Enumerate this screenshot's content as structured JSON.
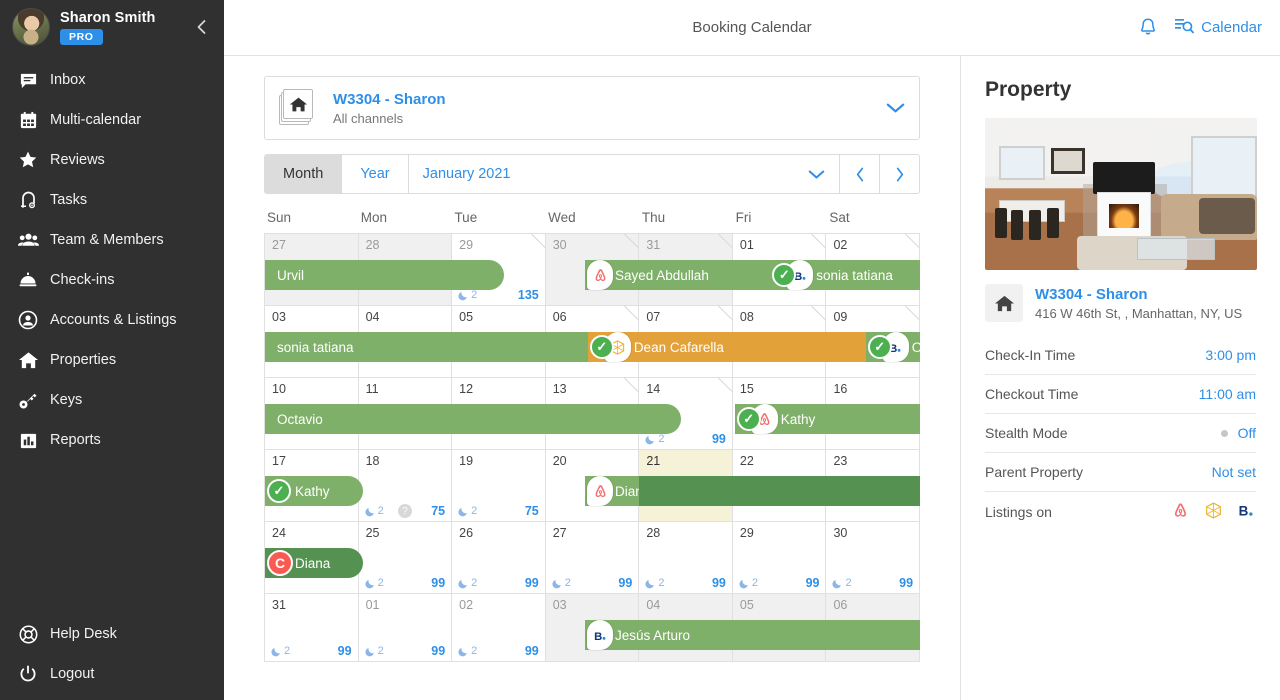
{
  "sidebar": {
    "user": {
      "name": "Sharon Smith",
      "badge": "PRO",
      "avatar_icon": "user-avatar"
    },
    "collapse_icon": "chevron-left-icon",
    "items": [
      {
        "label": "Inbox",
        "icon": "inbox-message-icon"
      },
      {
        "label": "Multi-calendar",
        "icon": "calendar-icon"
      },
      {
        "label": "Reviews",
        "icon": "star-icon"
      },
      {
        "label": "Tasks",
        "icon": "vacuum-icon"
      },
      {
        "label": "Team & Members",
        "icon": "people-icon"
      },
      {
        "label": "Check-ins",
        "icon": "bell-service-icon"
      },
      {
        "label": "Accounts & Listings",
        "icon": "account-circle-icon"
      },
      {
        "label": "Properties",
        "icon": "home-icon"
      },
      {
        "label": "Keys",
        "icon": "key-icon"
      },
      {
        "label": "Reports",
        "icon": "bar-chart-icon"
      }
    ],
    "bottom_items": [
      {
        "label": "Help Desk",
        "icon": "lifebuoy-icon"
      },
      {
        "label": "Logout",
        "icon": "power-icon"
      }
    ]
  },
  "topbar": {
    "title": "Booking Calendar",
    "notification_icon": "bell-icon",
    "calendar_label": "Calendar",
    "calendar_icon": "calendar-search-icon"
  },
  "property_selector": {
    "name": "W3304 - Sharon",
    "subtitle": "All channels",
    "icon": "properties-stack-icon",
    "caret_icon": "chevron-down-icon"
  },
  "toolbar": {
    "month_label": "Month",
    "year_label": "Year",
    "active": "Month",
    "period": "January 2021",
    "caret_icon": "chevron-down-icon",
    "prev_icon": "chevron-left-icon",
    "next_icon": "chevron-right-icon"
  },
  "calendar": {
    "dow": [
      "Sun",
      "Mon",
      "Tue",
      "Wed",
      "Thu",
      "Fri",
      "Sat"
    ],
    "weeks": [
      {
        "days": [
          {
            "n": "27",
            "cur": false
          },
          {
            "n": "28",
            "cur": false
          },
          {
            "n": "29",
            "cur": false,
            "white": true,
            "nights": "2",
            "price": "135",
            "diag": true
          },
          {
            "n": "30",
            "cur": false,
            "diag": true
          },
          {
            "n": "31",
            "cur": false,
            "diag": true
          },
          {
            "n": "01",
            "cur": true,
            "diag": true
          },
          {
            "n": "02",
            "cur": true,
            "diag": true
          }
        ],
        "bars": [
          {
            "label": "Urvil",
            "start": 0,
            "end": 2.55,
            "color": "green",
            "round": "right"
          },
          {
            "label": "Sayed Abdullah",
            "start": 3.42,
            "end": 5.4,
            "color": "green",
            "badges": [
              "airbnb"
            ]
          },
          {
            "label": "sonia tatiana",
            "start": 5.4,
            "end": 7,
            "color": "green",
            "badges": [
              "check",
              "booking"
            ]
          }
        ]
      },
      {
        "days": [
          {
            "n": "03",
            "cur": true
          },
          {
            "n": "04",
            "cur": true
          },
          {
            "n": "05",
            "cur": true
          },
          {
            "n": "06",
            "cur": true,
            "diag": true
          },
          {
            "n": "07",
            "cur": true,
            "diag": true
          },
          {
            "n": "08",
            "cur": true,
            "diag": true
          },
          {
            "n": "09",
            "cur": true,
            "diag": true
          }
        ],
        "bars": [
          {
            "label": "sonia tatiana",
            "start": 0,
            "end": 3.45,
            "color": "green"
          },
          {
            "label": "Dean Cafarella",
            "start": 3.45,
            "end": 6.42,
            "color": "orange",
            "badges": [
              "check",
              "home"
            ]
          },
          {
            "label": "Oc…",
            "start": 6.42,
            "end": 7,
            "color": "green",
            "badges": [
              "check",
              "booking"
            ]
          }
        ]
      },
      {
        "days": [
          {
            "n": "10",
            "cur": true
          },
          {
            "n": "11",
            "cur": true
          },
          {
            "n": "12",
            "cur": true
          },
          {
            "n": "13",
            "cur": true,
            "diag": true
          },
          {
            "n": "14",
            "cur": true,
            "white": true,
            "nights": "2",
            "price": "99",
            "diag": true
          },
          {
            "n": "15",
            "cur": true
          },
          {
            "n": "16",
            "cur": true
          }
        ],
        "bars": [
          {
            "label": "Octavio",
            "start": 0,
            "end": 4.45,
            "color": "green",
            "round": "right"
          },
          {
            "label": "Kathy",
            "start": 5.02,
            "end": 7,
            "color": "green",
            "badges": [
              "check",
              "airbnb"
            ]
          }
        ]
      },
      {
        "days": [
          {
            "n": "17",
            "cur": true
          },
          {
            "n": "18",
            "cur": true,
            "white": true,
            "nights": "2",
            "price": "75",
            "qmark": true
          },
          {
            "n": "19",
            "cur": true,
            "white": true,
            "nights": "2",
            "price": "75"
          },
          {
            "n": "20",
            "cur": true
          },
          {
            "n": "21",
            "cur": true,
            "today": true
          },
          {
            "n": "22",
            "cur": true
          },
          {
            "n": "23",
            "cur": true
          }
        ],
        "bars": [
          {
            "label": "Kathy",
            "start": 0,
            "end": 1.05,
            "color": "green",
            "round": "right",
            "badges": [
              "check-plain"
            ]
          },
          {
            "label": "Diana",
            "start": 3.42,
            "end": 4.0,
            "color": "green",
            "badges": [
              "airbnb"
            ]
          },
          {
            "label": "",
            "start": 4.0,
            "end": 7,
            "color": "green2"
          }
        ]
      },
      {
        "days": [
          {
            "n": "24",
            "cur": true
          },
          {
            "n": "25",
            "cur": true,
            "white": true,
            "nights": "2",
            "price": "99"
          },
          {
            "n": "26",
            "cur": true,
            "white": true,
            "nights": "2",
            "price": "99"
          },
          {
            "n": "27",
            "cur": true,
            "white": true,
            "nights": "2",
            "price": "99"
          },
          {
            "n": "28",
            "cur": true,
            "white": true,
            "nights": "2",
            "price": "99"
          },
          {
            "n": "29",
            "cur": true,
            "white": true,
            "nights": "2",
            "price": "99"
          },
          {
            "n": "30",
            "cur": true,
            "white": true,
            "nights": "2",
            "price": "99"
          }
        ],
        "bars": [
          {
            "label": "Diana",
            "start": 0,
            "end": 1.05,
            "color": "green2",
            "round": "right",
            "badges": [
              "c-badge"
            ]
          }
        ]
      },
      {
        "days": [
          {
            "n": "31",
            "cur": true,
            "white": true,
            "nights": "2",
            "price": "99"
          },
          {
            "n": "01",
            "cur": false,
            "white": true,
            "nights": "2",
            "price": "99"
          },
          {
            "n": "02",
            "cur": false,
            "white": true,
            "nights": "2",
            "price": "99"
          },
          {
            "n": "03",
            "cur": false
          },
          {
            "n": "04",
            "cur": false
          },
          {
            "n": "05",
            "cur": false
          },
          {
            "n": "06",
            "cur": false
          }
        ],
        "bars": [
          {
            "label": "Jesús Arturo",
            "start": 3.42,
            "end": 7,
            "color": "green",
            "badges": [
              "booking"
            ]
          }
        ]
      }
    ]
  },
  "property_panel": {
    "title": "Property",
    "photo_alt": "living-room-photo",
    "name": "W3304 - Sharon",
    "address": "416 W 46th St, , Manhattan, NY, US",
    "rows": [
      {
        "key": "Check-In Time",
        "value": "3:00 pm"
      },
      {
        "key": "Checkout Time",
        "value": "11:00 am"
      },
      {
        "key": "Stealth Mode",
        "value": "Off",
        "dot": true
      },
      {
        "key": "Parent Property",
        "value": "Not set"
      }
    ],
    "listings_label": "Listings on",
    "listings": [
      "airbnb-icon",
      "homeaway-icon",
      "booking-icon"
    ]
  },
  "colors": {
    "accent": "#2e8fe8",
    "booking_green": "#7fb069",
    "booking_green_dark": "#559150",
    "booking_orange": "#e3a13a",
    "sidebar_bg": "#303030",
    "today_bg": "#f5f2d8",
    "c_badge_red": "#fb5a52",
    "check_green": "#4caf50"
  }
}
